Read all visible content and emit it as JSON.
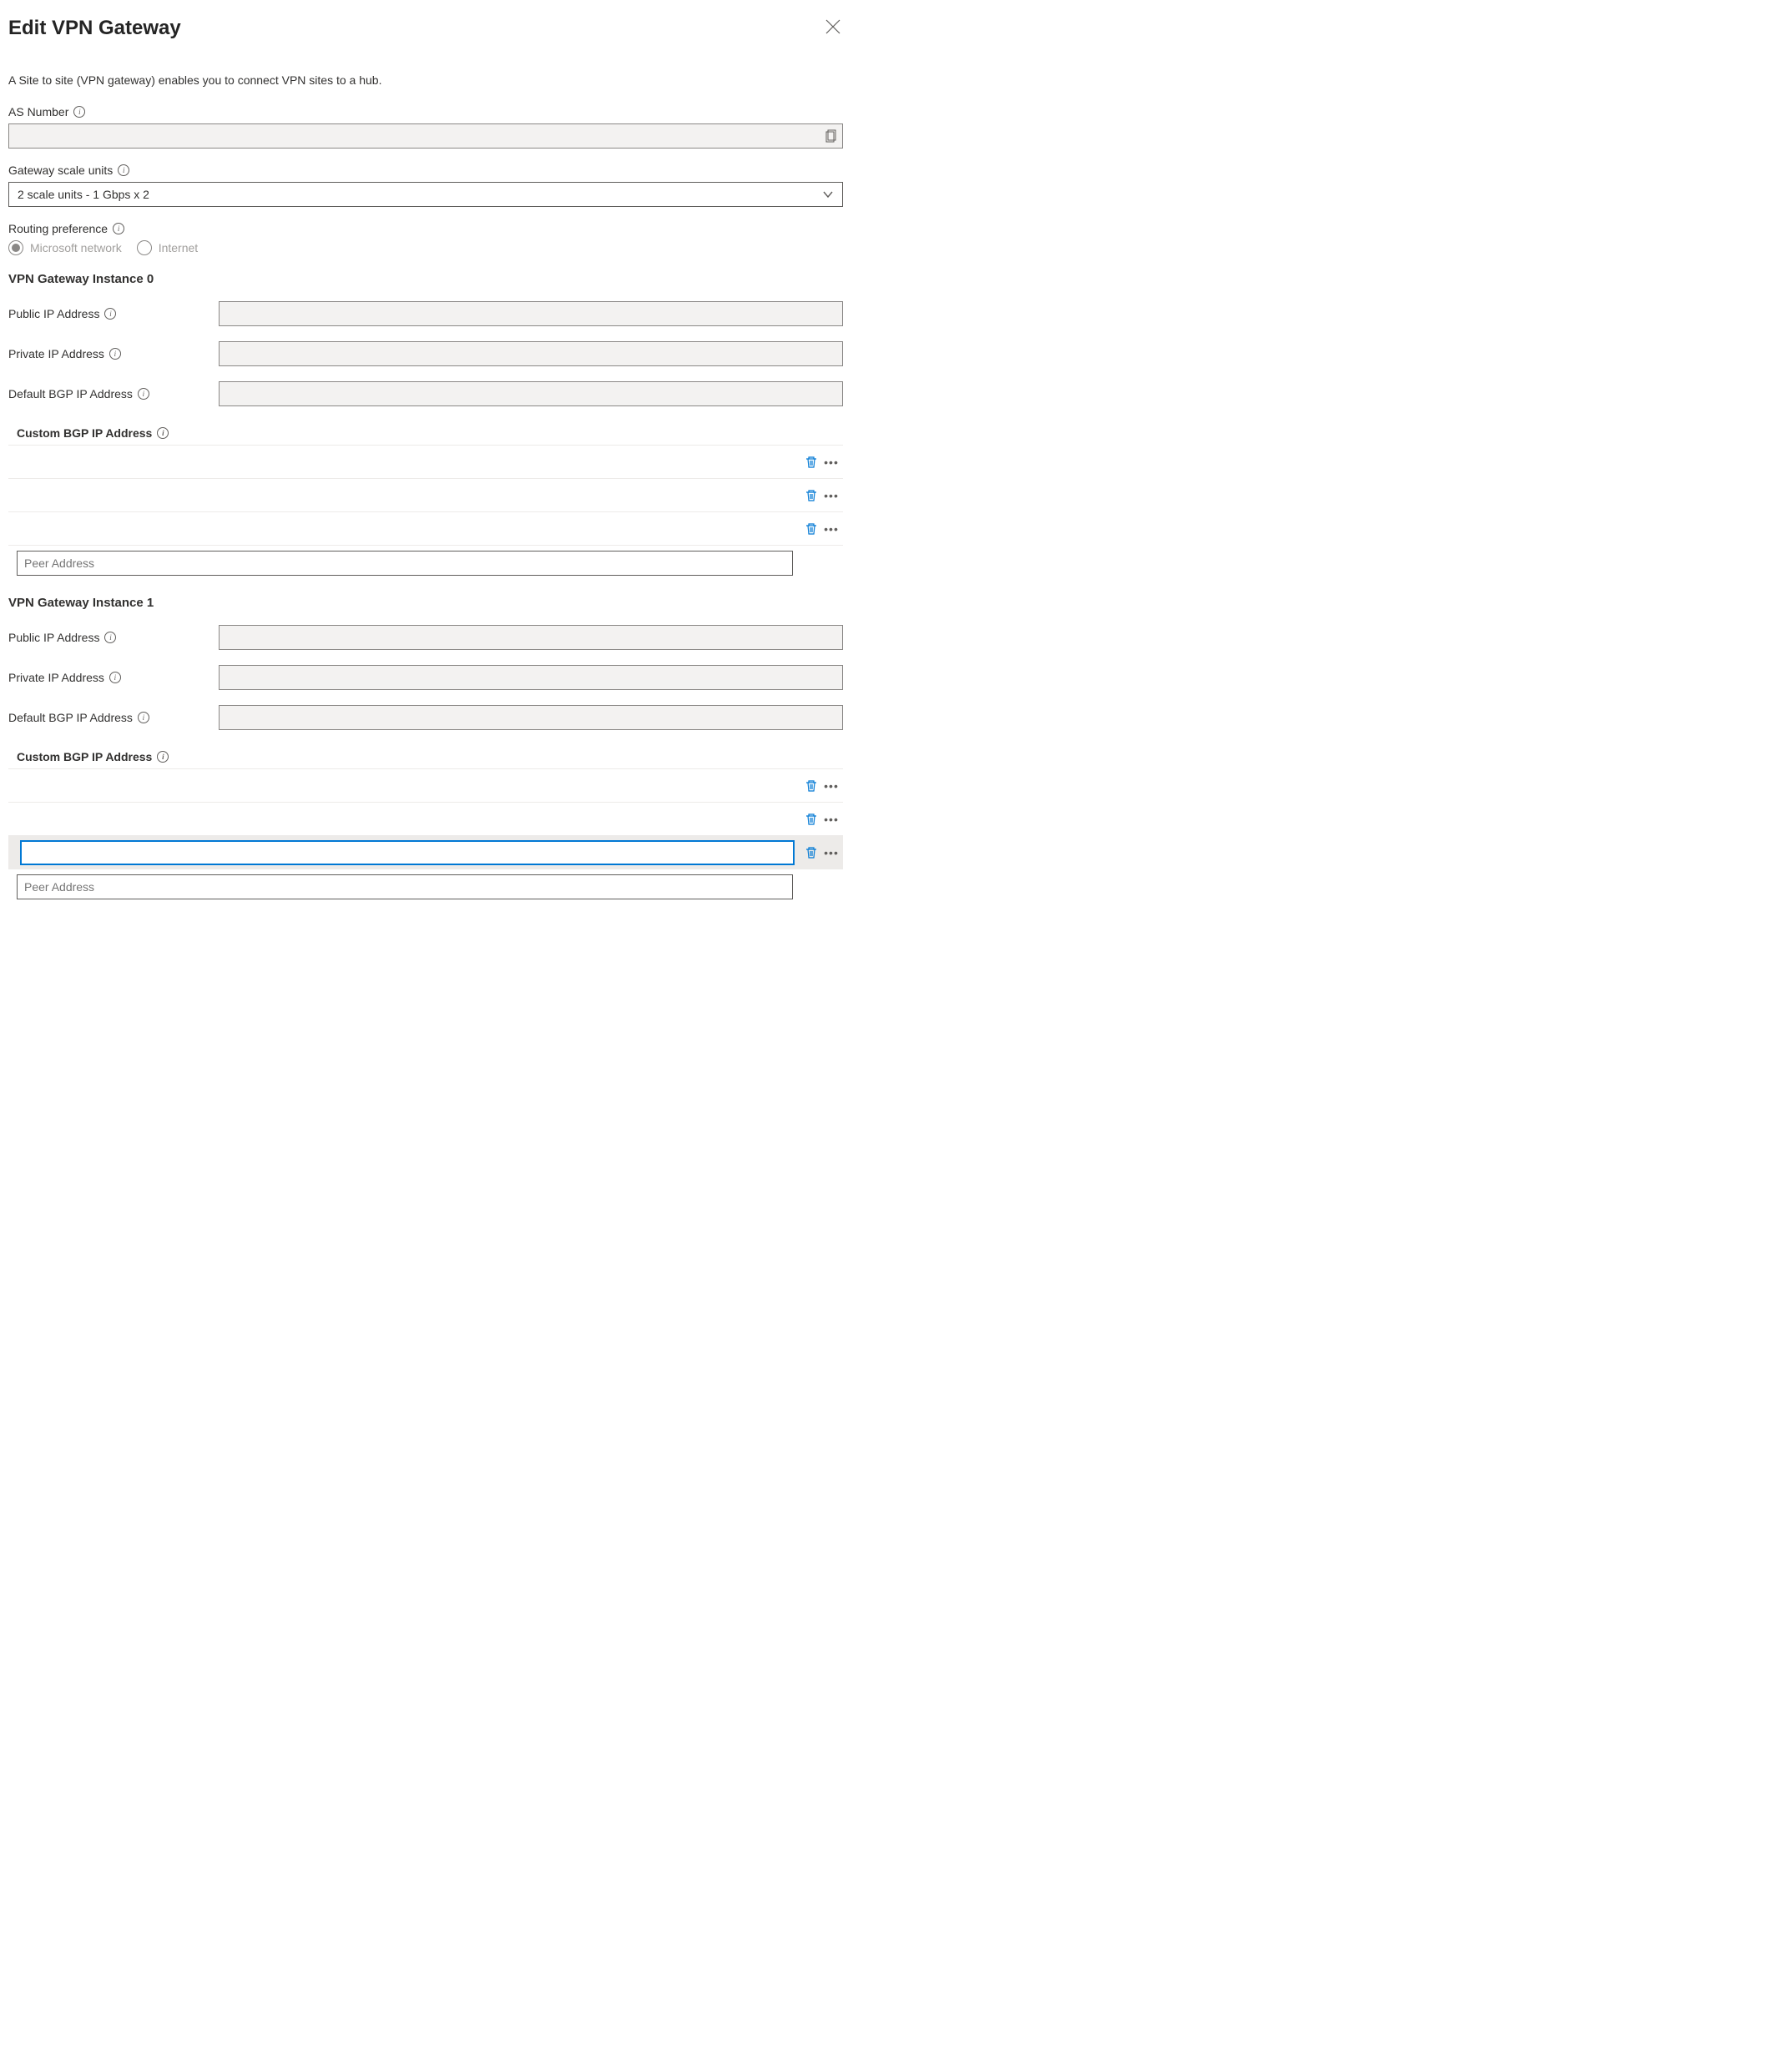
{
  "header": {
    "title": "Edit VPN Gateway"
  },
  "description": "A Site to site (VPN gateway) enables you to connect VPN sites to a hub.",
  "fields": {
    "as_number_label": "AS Number",
    "gateway_scale_label": "Gateway scale units",
    "gateway_scale_value": "2 scale units - 1 Gbps x 2",
    "routing_pref_label": "Routing preference",
    "routing_options": {
      "microsoft": "Microsoft network",
      "internet": "Internet"
    }
  },
  "instances": [
    {
      "heading": "VPN Gateway Instance 0",
      "public_ip_label": "Public IP Address",
      "private_ip_label": "Private IP Address",
      "default_bgp_label": "Default BGP IP Address",
      "custom_bgp_heading": "Custom BGP IP Address",
      "rows": 3,
      "peer_placeholder": "Peer Address"
    },
    {
      "heading": "VPN Gateway Instance 1",
      "public_ip_label": "Public IP Address",
      "private_ip_label": "Private IP Address",
      "default_bgp_label": "Default BGP IP Address",
      "custom_bgp_heading": "Custom BGP IP Address",
      "rows": 3,
      "peer_placeholder": "Peer Address"
    }
  ]
}
